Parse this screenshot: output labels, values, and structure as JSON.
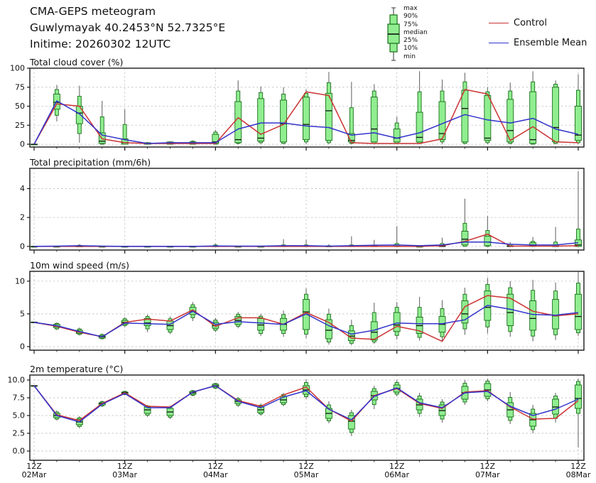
{
  "header": {
    "line1": "CMA-GEPS meteogram",
    "line2": "Guwlymayak 40.2453°N 52.7325°E",
    "line3": "Initime: 20260302 12UTC"
  },
  "legend": {
    "box_labels": [
      "max",
      "90%",
      "75%",
      "median",
      "25%",
      "10%",
      "min"
    ],
    "control_label": "Control",
    "ensemble_label": "Ensemble Mean"
  },
  "colors": {
    "control": "#cc3333",
    "ensemble": "#3333cc",
    "box_fill": "#90ee90",
    "box_edge": "#1a6e1a",
    "median": "#111111",
    "whisker": "#6b6b6b",
    "grid": "#c9c9c9",
    "axis": "#1a1a1a"
  },
  "x_axis": {
    "tick_top_label": "12Z",
    "day_labels": [
      "02Mar",
      "03Mar",
      "04Mar",
      "05Mar",
      "06Mar",
      "07Mar",
      "08Mar"
    ],
    "n_points": 25,
    "day_tick_indices": [
      0,
      4,
      8,
      12,
      16,
      20,
      24
    ]
  },
  "chart_data": [
    {
      "id": "cloud",
      "type": "boxplot-line",
      "title": "Total cloud cover (%)",
      "ylim": [
        -3.7,
        100
      ],
      "yticks": [
        0,
        25,
        50,
        75,
        100
      ],
      "ytick_labels": [
        "0",
        "25",
        "50",
        "75",
        "100"
      ],
      "control": [
        0,
        53,
        50,
        7,
        2,
        1,
        1,
        1,
        1,
        35,
        13,
        26,
        69,
        64,
        2,
        1,
        1,
        1,
        7,
        72,
        66,
        5,
        23,
        3,
        2
      ],
      "ensemble": [
        0,
        57,
        40,
        12,
        6,
        1,
        2,
        2,
        2,
        20,
        28,
        28,
        24,
        22,
        12,
        15,
        8,
        15,
        27,
        39,
        32,
        28,
        34,
        20,
        13
      ],
      "boxes": {
        "min": [
          0,
          30,
          2,
          0,
          0,
          0,
          0,
          0,
          0,
          0,
          0,
          0,
          0,
          0,
          0,
          0,
          0,
          0,
          0,
          0,
          0,
          0,
          0,
          0,
          0
        ],
        "p10": [
          0,
          38,
          14,
          0,
          0,
          0,
          0,
          0,
          0,
          1,
          2,
          1,
          3,
          2,
          1,
          1,
          1,
          1,
          3,
          1,
          2,
          1,
          0,
          1,
          2
        ],
        "p25": [
          0,
          46,
          27,
          1,
          0,
          0,
          0,
          0,
          1,
          2,
          4,
          3,
          6,
          5,
          3,
          3,
          3,
          3,
          6,
          3,
          5,
          3,
          1,
          3,
          5
        ],
        "median": [
          0,
          55,
          41,
          4,
          2,
          1,
          1,
          1,
          3,
          6,
          8,
          27,
          26,
          44,
          5,
          20,
          8,
          9,
          14,
          47,
          8,
          18,
          6,
          22,
          12
        ],
        "p75": [
          0,
          66,
          50,
          15,
          7,
          2,
          3,
          3,
          13,
          56,
          60,
          58,
          62,
          67,
          14,
          62,
          20,
          42,
          56,
          71,
          64,
          59,
          69,
          75,
          50
        ],
        "p90": [
          0,
          72,
          63,
          36,
          26,
          2,
          3,
          4,
          16,
          70,
          68,
          66,
          67,
          81,
          48,
          70,
          28,
          69,
          70,
          82,
          69,
          70,
          82,
          79,
          71
        ],
        "max": [
          0,
          78,
          77,
          57,
          46,
          3,
          4,
          5,
          19,
          84,
          76,
          75,
          72,
          95,
          82,
          79,
          36,
          96,
          85,
          94,
          75,
          81,
          96,
          84,
          92
        ]
      }
    },
    {
      "id": "precip",
      "type": "boxplot-line",
      "title": "Total precipitation (mm/6h)",
      "ylim": [
        -0.25,
        5.4
      ],
      "yticks": [
        0,
        2,
        4
      ],
      "ytick_labels": [
        "0",
        "2",
        "4"
      ],
      "control": [
        0,
        0,
        0,
        0,
        0,
        0,
        0,
        0,
        0,
        0,
        0,
        0,
        0,
        0,
        0,
        0,
        0,
        0,
        0.05,
        0.35,
        0.85,
        0.02,
        0.02,
        0.02,
        0.05
      ],
      "ensemble": [
        0,
        0.02,
        0.05,
        0.02,
        0,
        0,
        0,
        0,
        0.03,
        0.02,
        0.02,
        0.05,
        0.05,
        0.02,
        0.05,
        0.08,
        0.1,
        0.05,
        0.1,
        0.3,
        0.3,
        0.15,
        0.1,
        0.1,
        0.25
      ],
      "boxes": {
        "min": [
          0,
          0,
          0,
          0,
          0,
          0,
          0,
          0,
          0,
          0,
          0,
          0,
          0,
          0,
          0,
          0,
          0,
          0,
          0,
          0,
          0,
          0,
          0,
          0,
          0
        ],
        "p10": [
          0,
          0,
          0,
          0,
          0,
          0,
          0,
          0,
          0,
          0,
          0,
          0,
          0,
          0,
          0,
          0,
          0,
          0,
          0,
          0,
          0,
          0,
          0,
          0,
          0
        ],
        "p25": [
          0,
          0,
          0,
          0,
          0,
          0,
          0,
          0,
          0,
          0,
          0,
          0,
          0,
          0,
          0,
          0,
          0,
          0,
          0,
          0.1,
          0.05,
          0,
          0,
          0,
          0
        ],
        "median": [
          0,
          0,
          0,
          0,
          0,
          0,
          0,
          0,
          0,
          0,
          0,
          0,
          0,
          0,
          0,
          0,
          0,
          0,
          0,
          0.5,
          0.3,
          0,
          0.05,
          0,
          0.1
        ],
        "p75": [
          0,
          0,
          0.02,
          0,
          0,
          0,
          0,
          0,
          0.03,
          0,
          0,
          0.05,
          0.05,
          0.02,
          0.05,
          0.05,
          0.1,
          0,
          0.05,
          1.05,
          0.7,
          0.05,
          0.25,
          0.1,
          0.45
        ],
        "p90": [
          0,
          0,
          0.08,
          0,
          0,
          0,
          0,
          0,
          0.1,
          0,
          0,
          0.1,
          0.1,
          0.05,
          0.1,
          0.1,
          0.2,
          0,
          0.2,
          1.6,
          1.1,
          0.15,
          0.35,
          0.3,
          1.2
        ],
        "max": [
          0,
          0,
          0.15,
          0,
          0,
          0,
          0,
          0,
          0.2,
          0,
          0,
          0.5,
          0.45,
          0.15,
          0.7,
          0.45,
          1.4,
          0,
          0.6,
          3.3,
          2.1,
          0.3,
          0.65,
          1.35,
          5.2
        ]
      }
    },
    {
      "id": "wind",
      "type": "boxplot-line",
      "title": "10m wind speed (m/s)",
      "ylim": [
        -0.55,
        11.5
      ],
      "yticks": [
        0,
        5,
        10
      ],
      "ytick_labels": [
        "0",
        "5",
        "10"
      ],
      "control": [
        3.7,
        3.1,
        2.2,
        1.5,
        3.7,
        4.2,
        3.9,
        5.6,
        3.1,
        4.4,
        4.4,
        3.4,
        5.2,
        3.7,
        1.3,
        1.1,
        3.1,
        2.4,
        0.8,
        6.1,
        7.8,
        7.4,
        5.4,
        4.7,
        5.0
      ],
      "ensemble": [
        3.7,
        3.2,
        2.3,
        1.5,
        3.6,
        3.5,
        3.4,
        5.4,
        3.4,
        3.8,
        3.6,
        3.4,
        5.0,
        3.2,
        1.9,
        2.5,
        3.6,
        3.5,
        3.5,
        4.1,
        6.3,
        5.7,
        4.9,
        4.8,
        5.2
      ],
      "boxes": {
        "min": [
          3.6,
          2.5,
          1.7,
          1.1,
          3.0,
          2.2,
          1.9,
          3.9,
          2.2,
          2.8,
          1.6,
          1.5,
          1.3,
          0.3,
          0.2,
          0.4,
          1.1,
          0.9,
          0.8,
          1.8,
          2.0,
          1.5,
          0.8,
          1.0,
          1.6
        ],
        "p10": [
          3.65,
          2.7,
          1.85,
          1.2,
          3.2,
          2.7,
          2.2,
          4.4,
          2.5,
          3.1,
          2.0,
          2.0,
          1.9,
          0.7,
          0.5,
          0.7,
          1.7,
          1.4,
          1.5,
          2.7,
          3.0,
          2.3,
          1.6,
          1.8,
          2.1
        ],
        "p25": [
          3.65,
          2.9,
          2.0,
          1.3,
          3.4,
          3.2,
          2.6,
          4.9,
          2.8,
          3.4,
          2.5,
          2.5,
          2.6,
          1.2,
          0.9,
          1.0,
          2.3,
          2.0,
          2.2,
          3.6,
          4.0,
          3.2,
          2.5,
          2.7,
          2.6
        ],
        "median": [
          3.7,
          3.1,
          2.2,
          1.5,
          3.7,
          3.6,
          3.2,
          5.4,
          3.2,
          4.0,
          3.3,
          3.4,
          5.3,
          2.5,
          1.6,
          2.2,
          3.3,
          3.2,
          3.4,
          5.0,
          6.0,
          5.2,
          4.3,
          4.7,
          4.6
        ],
        "p75": [
          3.75,
          3.4,
          2.5,
          1.7,
          4.0,
          4.3,
          3.9,
          6.0,
          3.7,
          4.6,
          4.3,
          4.3,
          7.2,
          4.1,
          2.4,
          3.8,
          5.2,
          4.5,
          4.6,
          7.0,
          8.5,
          8.0,
          7.0,
          7.2,
          8.0
        ],
        "p90": [
          3.75,
          3.55,
          2.7,
          1.85,
          4.25,
          4.6,
          4.25,
          6.4,
          4.05,
          4.95,
          4.65,
          4.9,
          8.0,
          4.95,
          3.2,
          5.2,
          6.0,
          6.0,
          5.8,
          8.0,
          9.5,
          9.0,
          8.6,
          8.5,
          9.7
        ],
        "max": [
          3.8,
          3.7,
          2.9,
          2.0,
          4.5,
          4.9,
          4.6,
          6.8,
          4.4,
          5.3,
          5.0,
          5.5,
          8.9,
          5.8,
          4.1,
          6.7,
          6.8,
          7.6,
          7.1,
          9.0,
          10.5,
          10.0,
          10.2,
          9.8,
          11.4
        ]
      }
    },
    {
      "id": "temp",
      "type": "boxplot-line",
      "title": "2m temperature (°C)",
      "ylim": [
        -1.3,
        10.7
      ],
      "yticks": [
        0,
        2.5,
        5,
        7.5,
        10
      ],
      "ytick_labels": [
        "0.0",
        "2.5",
        "5.0",
        "7.5",
        "10.0"
      ],
      "control": [
        9.2,
        5.1,
        4.3,
        6.7,
        8.2,
        6.3,
        6.2,
        8.3,
        9.2,
        7.1,
        6.3,
        7.9,
        9.0,
        5.9,
        4.2,
        7.8,
        8.8,
        6.7,
        6.0,
        8.3,
        8.5,
        6.2,
        4.5,
        4.6,
        7.1
      ],
      "ensemble": [
        9.2,
        5.0,
        4.1,
        6.6,
        8.1,
        6.1,
        6.1,
        8.3,
        9.2,
        7.0,
        6.1,
        7.6,
        8.5,
        5.9,
        4.4,
        7.7,
        8.9,
        6.8,
        6.1,
        8.2,
        8.4,
        6.3,
        5.0,
        5.9,
        7.3
      ],
      "boxes": {
        "min": [
          9.2,
          4.3,
          3.2,
          6.2,
          7.9,
          4.8,
          4.5,
          7.7,
          8.7,
          6.2,
          5.0,
          6.3,
          7.3,
          3.9,
          2.1,
          5.9,
          7.7,
          4.8,
          4.0,
          6.5,
          7.0,
          3.8,
          2.5,
          4.0,
          0.5
        ],
        "p10": [
          9.2,
          4.5,
          3.45,
          6.35,
          7.95,
          5.05,
          4.75,
          7.85,
          8.85,
          6.45,
          5.2,
          6.55,
          7.65,
          4.25,
          2.6,
          6.55,
          8.0,
          5.3,
          4.5,
          6.9,
          7.35,
          4.3,
          3.0,
          4.6,
          5.3
        ],
        "p25": [
          9.2,
          4.7,
          3.7,
          6.5,
          8.0,
          5.3,
          5.0,
          8.0,
          9.0,
          6.7,
          5.4,
          6.8,
          8.0,
          4.6,
          3.1,
          7.2,
          8.3,
          5.8,
          5.0,
          7.3,
          7.7,
          4.8,
          3.5,
          5.2,
          6.0
        ],
        "median": [
          9.2,
          5.0,
          4.1,
          6.7,
          8.2,
          5.8,
          5.5,
          8.2,
          9.2,
          7.0,
          5.8,
          7.2,
          8.6,
          5.3,
          4.2,
          7.8,
          8.8,
          6.5,
          5.7,
          8.2,
          8.6,
          5.8,
          4.4,
          6.2,
          7.4
        ],
        "p75": [
          9.2,
          5.3,
          4.5,
          6.8,
          8.3,
          6.2,
          6.0,
          8.4,
          9.4,
          7.2,
          6.2,
          7.7,
          9.2,
          6.0,
          5.0,
          8.4,
          9.3,
          7.3,
          6.5,
          9.1,
          9.5,
          6.8,
          5.3,
          7.3,
          9.3
        ],
        "p90": [
          9.2,
          5.5,
          4.7,
          6.95,
          8.4,
          6.35,
          6.2,
          8.5,
          9.5,
          7.4,
          6.45,
          7.95,
          9.65,
          6.5,
          5.4,
          8.8,
          9.65,
          7.75,
          6.9,
          9.55,
          9.85,
          7.55,
          5.9,
          7.75,
          9.8
        ],
        "max": [
          9.2,
          5.7,
          4.9,
          7.1,
          8.5,
          6.5,
          6.4,
          8.6,
          9.6,
          7.6,
          6.7,
          8.2,
          10.1,
          7.0,
          5.8,
          9.2,
          10.0,
          8.2,
          7.3,
          10.0,
          10.2,
          8.3,
          6.5,
          8.2,
          10.2
        ]
      }
    }
  ]
}
